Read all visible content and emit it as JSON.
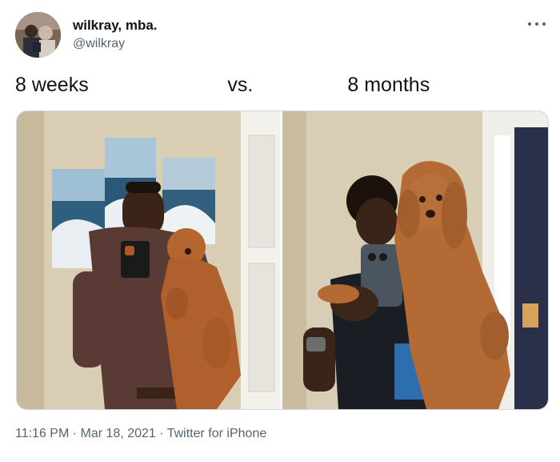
{
  "author": {
    "name": "wilkray, mba.",
    "handle": "@wilkray"
  },
  "tweet": {
    "text": "8 weeks                         vs.                 8 months"
  },
  "media": [
    {
      "alt": "8 weeks photo"
    },
    {
      "alt": "8 months photo"
    }
  ],
  "meta": {
    "time": "11:16 PM",
    "sep1": " · ",
    "date": "Mar 18, 2021",
    "sep2": " · ",
    "client": "Twitter for iPhone"
  },
  "colors": {
    "text": "#0f1419",
    "secondary": "#536471",
    "border": "#cfd9de"
  }
}
